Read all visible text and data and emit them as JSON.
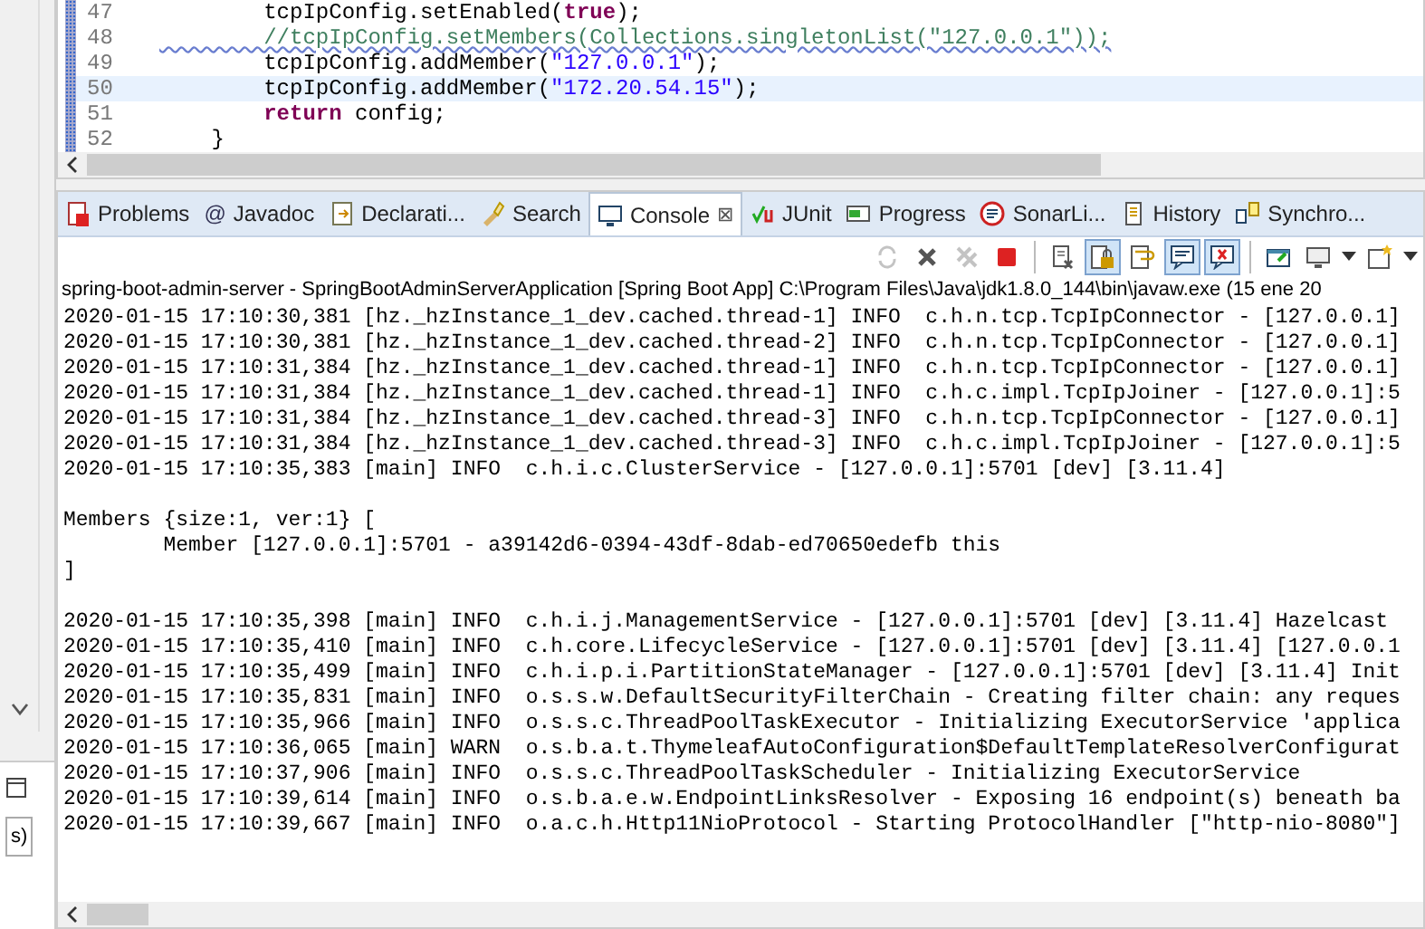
{
  "editor": {
    "lines": [
      {
        "number": "47",
        "current": false,
        "warning": false,
        "tokens": [
          {
            "kind": "plain",
            "text": "        tcpIpConfig.setEnabled("
          },
          {
            "kind": "keyword",
            "text": "true"
          },
          {
            "kind": "plain",
            "text": ");"
          }
        ]
      },
      {
        "number": "48",
        "current": false,
        "warning": true,
        "tokens": [
          {
            "kind": "comment",
            "text": "        //tcpIpConfig.setMembers(Collections.singletonList(\"127.0.0.1\"));"
          }
        ]
      },
      {
        "number": "49",
        "current": false,
        "warning": false,
        "tokens": [
          {
            "kind": "plain",
            "text": "        tcpIpConfig.addMember("
          },
          {
            "kind": "string",
            "text": "\"127.0.0.1\""
          },
          {
            "kind": "plain",
            "text": ");"
          }
        ]
      },
      {
        "number": "50",
        "current": true,
        "warning": false,
        "tokens": [
          {
            "kind": "plain",
            "text": "        tcpIpConfig.addMember("
          },
          {
            "kind": "string",
            "text": "\"172.20.54.15\""
          },
          {
            "kind": "plain",
            "text": ");"
          }
        ]
      },
      {
        "number": "51",
        "current": false,
        "warning": false,
        "tokens": [
          {
            "kind": "keyword",
            "text": "        return"
          },
          {
            "kind": "plain",
            "text": " config;"
          }
        ]
      },
      {
        "number": "52",
        "current": false,
        "warning": false,
        "tokens": [
          {
            "kind": "plain",
            "text": "    }"
          }
        ]
      }
    ]
  },
  "left_panel": {
    "field_text": "s)"
  },
  "tabs": [
    {
      "kind": "problems",
      "label": "Problems",
      "selected": false
    },
    {
      "kind": "javadoc",
      "glyph": "@",
      "label": "Javadoc",
      "selected": false
    },
    {
      "kind": "declaration",
      "label": "Declarati...",
      "selected": false
    },
    {
      "kind": "search",
      "label": "Search",
      "selected": false
    },
    {
      "kind": "console",
      "label": "Console",
      "selected": true,
      "close": "⊠"
    },
    {
      "kind": "junit",
      "label": "JUnit",
      "selected": false
    },
    {
      "kind": "progress",
      "label": "Progress",
      "selected": false
    },
    {
      "kind": "sonar",
      "label": "SonarLi...",
      "selected": false
    },
    {
      "kind": "history",
      "label": "History",
      "selected": false
    },
    {
      "kind": "sync",
      "label": "Synchro...",
      "selected": false
    }
  ],
  "toolbar": [
    {
      "kind": "sync",
      "disabled": true,
      "on": false
    },
    {
      "kind": "remove",
      "disabled": false,
      "on": false
    },
    {
      "kind": "remove-all",
      "disabled": true,
      "on": false
    },
    {
      "kind": "stop",
      "disabled": false,
      "on": false
    },
    {
      "kind": "sep"
    },
    {
      "kind": "clear",
      "disabled": false,
      "on": false
    },
    {
      "kind": "scroll-lock",
      "disabled": false,
      "on": true
    },
    {
      "kind": "word-wrap",
      "disabled": false,
      "on": false
    },
    {
      "kind": "stdout",
      "disabled": false,
      "on": true
    },
    {
      "kind": "stderr",
      "disabled": false,
      "on": true
    },
    {
      "kind": "sep"
    },
    {
      "kind": "pin",
      "disabled": false,
      "on": false
    },
    {
      "kind": "display",
      "disabled": false,
      "on": false
    },
    {
      "kind": "caret",
      "disabled": false,
      "on": false
    },
    {
      "kind": "new-console",
      "disabled": false,
      "on": false
    },
    {
      "kind": "caret",
      "disabled": false,
      "on": false
    }
  ],
  "console": {
    "header": "spring-boot-admin-server - SpringBootAdminServerApplication [Spring Boot App] C:\\Program Files\\Java\\jdk1.8.0_144\\bin\\javaw.exe (15 ene 20",
    "lines": [
      {
        "kind": "text",
        "text": "2020-01-15 17:10:30,381 [hz._hzInstance_1_dev.cached.thread-1] INFO  c.h.n.tcp.TcpIpConnector - [127.0.0.1]"
      },
      {
        "kind": "text",
        "text": "2020-01-15 17:10:30,381 [hz._hzInstance_1_dev.cached.thread-2] INFO  c.h.n.tcp.TcpIpConnector - [127.0.0.1]"
      },
      {
        "kind": "text",
        "text": "2020-01-15 17:10:31,384 [hz._hzInstance_1_dev.cached.thread-1] INFO  c.h.n.tcp.TcpIpConnector - [127.0.0.1]"
      },
      {
        "kind": "text",
        "text": "2020-01-15 17:10:31,384 [hz._hzInstance_1_dev.cached.thread-1] INFO  c.h.c.impl.TcpIpJoiner - [127.0.0.1]:5"
      },
      {
        "kind": "text",
        "text": "2020-01-15 17:10:31,384 [hz._hzInstance_1_dev.cached.thread-3] INFO  c.h.n.tcp.TcpIpConnector - [127.0.0.1]"
      },
      {
        "kind": "text",
        "text": "2020-01-15 17:10:31,384 [hz._hzInstance_1_dev.cached.thread-3] INFO  c.h.c.impl.TcpIpJoiner - [127.0.0.1]:5"
      },
      {
        "kind": "text",
        "text": "2020-01-15 17:10:35,383 [main] INFO  c.h.i.c.ClusterService - [127.0.0.1]:5701 [dev] [3.11.4]"
      },
      {
        "kind": "blank"
      },
      {
        "kind": "text",
        "text": "Members {size:1, ver:1} ["
      },
      {
        "kind": "text",
        "text": "        Member [127.0.0.1]:5701 - a39142d6-0394-43df-8dab-ed70650edefb this"
      },
      {
        "kind": "text",
        "text": "]"
      },
      {
        "kind": "blank"
      },
      {
        "kind": "text",
        "text": "2020-01-15 17:10:35,398 [main] INFO  c.h.i.j.ManagementService - [127.0.0.1]:5701 [dev] [3.11.4] Hazelcast"
      },
      {
        "kind": "text",
        "text": "2020-01-15 17:10:35,410 [main] INFO  c.h.core.LifecycleService - [127.0.0.1]:5701 [dev] [3.11.4] [127.0.0.1"
      },
      {
        "kind": "text",
        "text": "2020-01-15 17:10:35,499 [main] INFO  c.h.i.p.i.PartitionStateManager - [127.0.0.1]:5701 [dev] [3.11.4] Init"
      },
      {
        "kind": "text",
        "text": "2020-01-15 17:10:35,831 [main] INFO  o.s.s.w.DefaultSecurityFilterChain - Creating filter chain: any reques"
      },
      {
        "kind": "text",
        "text": "2020-01-15 17:10:35,966 [main] INFO  o.s.s.c.ThreadPoolTaskExecutor - Initializing ExecutorService 'applica"
      },
      {
        "kind": "text",
        "text": "2020-01-15 17:10:36,065 [main] WARN  o.s.b.a.t.ThymeleafAutoConfiguration$DefaultTemplateResolverConfigurat"
      },
      {
        "kind": "text",
        "text": "2020-01-15 17:10:37,906 [main] INFO  o.s.s.c.ThreadPoolTaskScheduler - Initializing ExecutorService"
      },
      {
        "kind": "text",
        "text": "2020-01-15 17:10:39,614 [main] INFO  o.s.b.a.e.w.EndpointLinksResolver - Exposing 16 endpoint(s) beneath ba"
      },
      {
        "kind": "text",
        "text": "2020-01-15 17:10:39,667 [main] INFO  o.a.c.h.Http11NioProtocol - Starting ProtocolHandler [\"http-nio-8080\"]"
      }
    ]
  }
}
